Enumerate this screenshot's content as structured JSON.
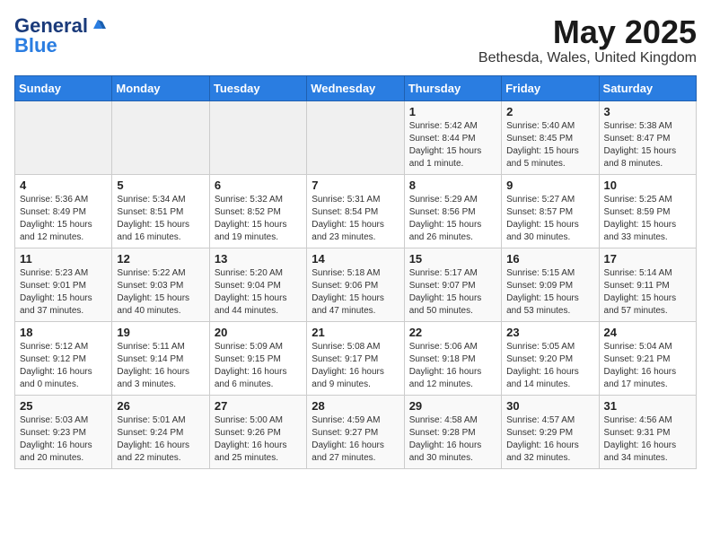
{
  "header": {
    "logo_general": "General",
    "logo_blue": "Blue",
    "title": "May 2025",
    "subtitle": "Bethesda, Wales, United Kingdom"
  },
  "calendar": {
    "days_of_week": [
      "Sunday",
      "Monday",
      "Tuesday",
      "Wednesday",
      "Thursday",
      "Friday",
      "Saturday"
    ],
    "weeks": [
      [
        {
          "day": "",
          "info": ""
        },
        {
          "day": "",
          "info": ""
        },
        {
          "day": "",
          "info": ""
        },
        {
          "day": "",
          "info": ""
        },
        {
          "day": "1",
          "info": "Sunrise: 5:42 AM\nSunset: 8:44 PM\nDaylight: 15 hours\nand 1 minute."
        },
        {
          "day": "2",
          "info": "Sunrise: 5:40 AM\nSunset: 8:45 PM\nDaylight: 15 hours\nand 5 minutes."
        },
        {
          "day": "3",
          "info": "Sunrise: 5:38 AM\nSunset: 8:47 PM\nDaylight: 15 hours\nand 8 minutes."
        }
      ],
      [
        {
          "day": "4",
          "info": "Sunrise: 5:36 AM\nSunset: 8:49 PM\nDaylight: 15 hours\nand 12 minutes."
        },
        {
          "day": "5",
          "info": "Sunrise: 5:34 AM\nSunset: 8:51 PM\nDaylight: 15 hours\nand 16 minutes."
        },
        {
          "day": "6",
          "info": "Sunrise: 5:32 AM\nSunset: 8:52 PM\nDaylight: 15 hours\nand 19 minutes."
        },
        {
          "day": "7",
          "info": "Sunrise: 5:31 AM\nSunset: 8:54 PM\nDaylight: 15 hours\nand 23 minutes."
        },
        {
          "day": "8",
          "info": "Sunrise: 5:29 AM\nSunset: 8:56 PM\nDaylight: 15 hours\nand 26 minutes."
        },
        {
          "day": "9",
          "info": "Sunrise: 5:27 AM\nSunset: 8:57 PM\nDaylight: 15 hours\nand 30 minutes."
        },
        {
          "day": "10",
          "info": "Sunrise: 5:25 AM\nSunset: 8:59 PM\nDaylight: 15 hours\nand 33 minutes."
        }
      ],
      [
        {
          "day": "11",
          "info": "Sunrise: 5:23 AM\nSunset: 9:01 PM\nDaylight: 15 hours\nand 37 minutes."
        },
        {
          "day": "12",
          "info": "Sunrise: 5:22 AM\nSunset: 9:03 PM\nDaylight: 15 hours\nand 40 minutes."
        },
        {
          "day": "13",
          "info": "Sunrise: 5:20 AM\nSunset: 9:04 PM\nDaylight: 15 hours\nand 44 minutes."
        },
        {
          "day": "14",
          "info": "Sunrise: 5:18 AM\nSunset: 9:06 PM\nDaylight: 15 hours\nand 47 minutes."
        },
        {
          "day": "15",
          "info": "Sunrise: 5:17 AM\nSunset: 9:07 PM\nDaylight: 15 hours\nand 50 minutes."
        },
        {
          "day": "16",
          "info": "Sunrise: 5:15 AM\nSunset: 9:09 PM\nDaylight: 15 hours\nand 53 minutes."
        },
        {
          "day": "17",
          "info": "Sunrise: 5:14 AM\nSunset: 9:11 PM\nDaylight: 15 hours\nand 57 minutes."
        }
      ],
      [
        {
          "day": "18",
          "info": "Sunrise: 5:12 AM\nSunset: 9:12 PM\nDaylight: 16 hours\nand 0 minutes."
        },
        {
          "day": "19",
          "info": "Sunrise: 5:11 AM\nSunset: 9:14 PM\nDaylight: 16 hours\nand 3 minutes."
        },
        {
          "day": "20",
          "info": "Sunrise: 5:09 AM\nSunset: 9:15 PM\nDaylight: 16 hours\nand 6 minutes."
        },
        {
          "day": "21",
          "info": "Sunrise: 5:08 AM\nSunset: 9:17 PM\nDaylight: 16 hours\nand 9 minutes."
        },
        {
          "day": "22",
          "info": "Sunrise: 5:06 AM\nSunset: 9:18 PM\nDaylight: 16 hours\nand 12 minutes."
        },
        {
          "day": "23",
          "info": "Sunrise: 5:05 AM\nSunset: 9:20 PM\nDaylight: 16 hours\nand 14 minutes."
        },
        {
          "day": "24",
          "info": "Sunrise: 5:04 AM\nSunset: 9:21 PM\nDaylight: 16 hours\nand 17 minutes."
        }
      ],
      [
        {
          "day": "25",
          "info": "Sunrise: 5:03 AM\nSunset: 9:23 PM\nDaylight: 16 hours\nand 20 minutes."
        },
        {
          "day": "26",
          "info": "Sunrise: 5:01 AM\nSunset: 9:24 PM\nDaylight: 16 hours\nand 22 minutes."
        },
        {
          "day": "27",
          "info": "Sunrise: 5:00 AM\nSunset: 9:26 PM\nDaylight: 16 hours\nand 25 minutes."
        },
        {
          "day": "28",
          "info": "Sunrise: 4:59 AM\nSunset: 9:27 PM\nDaylight: 16 hours\nand 27 minutes."
        },
        {
          "day": "29",
          "info": "Sunrise: 4:58 AM\nSunset: 9:28 PM\nDaylight: 16 hours\nand 30 minutes."
        },
        {
          "day": "30",
          "info": "Sunrise: 4:57 AM\nSunset: 9:29 PM\nDaylight: 16 hours\nand 32 minutes."
        },
        {
          "day": "31",
          "info": "Sunrise: 4:56 AM\nSunset: 9:31 PM\nDaylight: 16 hours\nand 34 minutes."
        }
      ]
    ]
  }
}
